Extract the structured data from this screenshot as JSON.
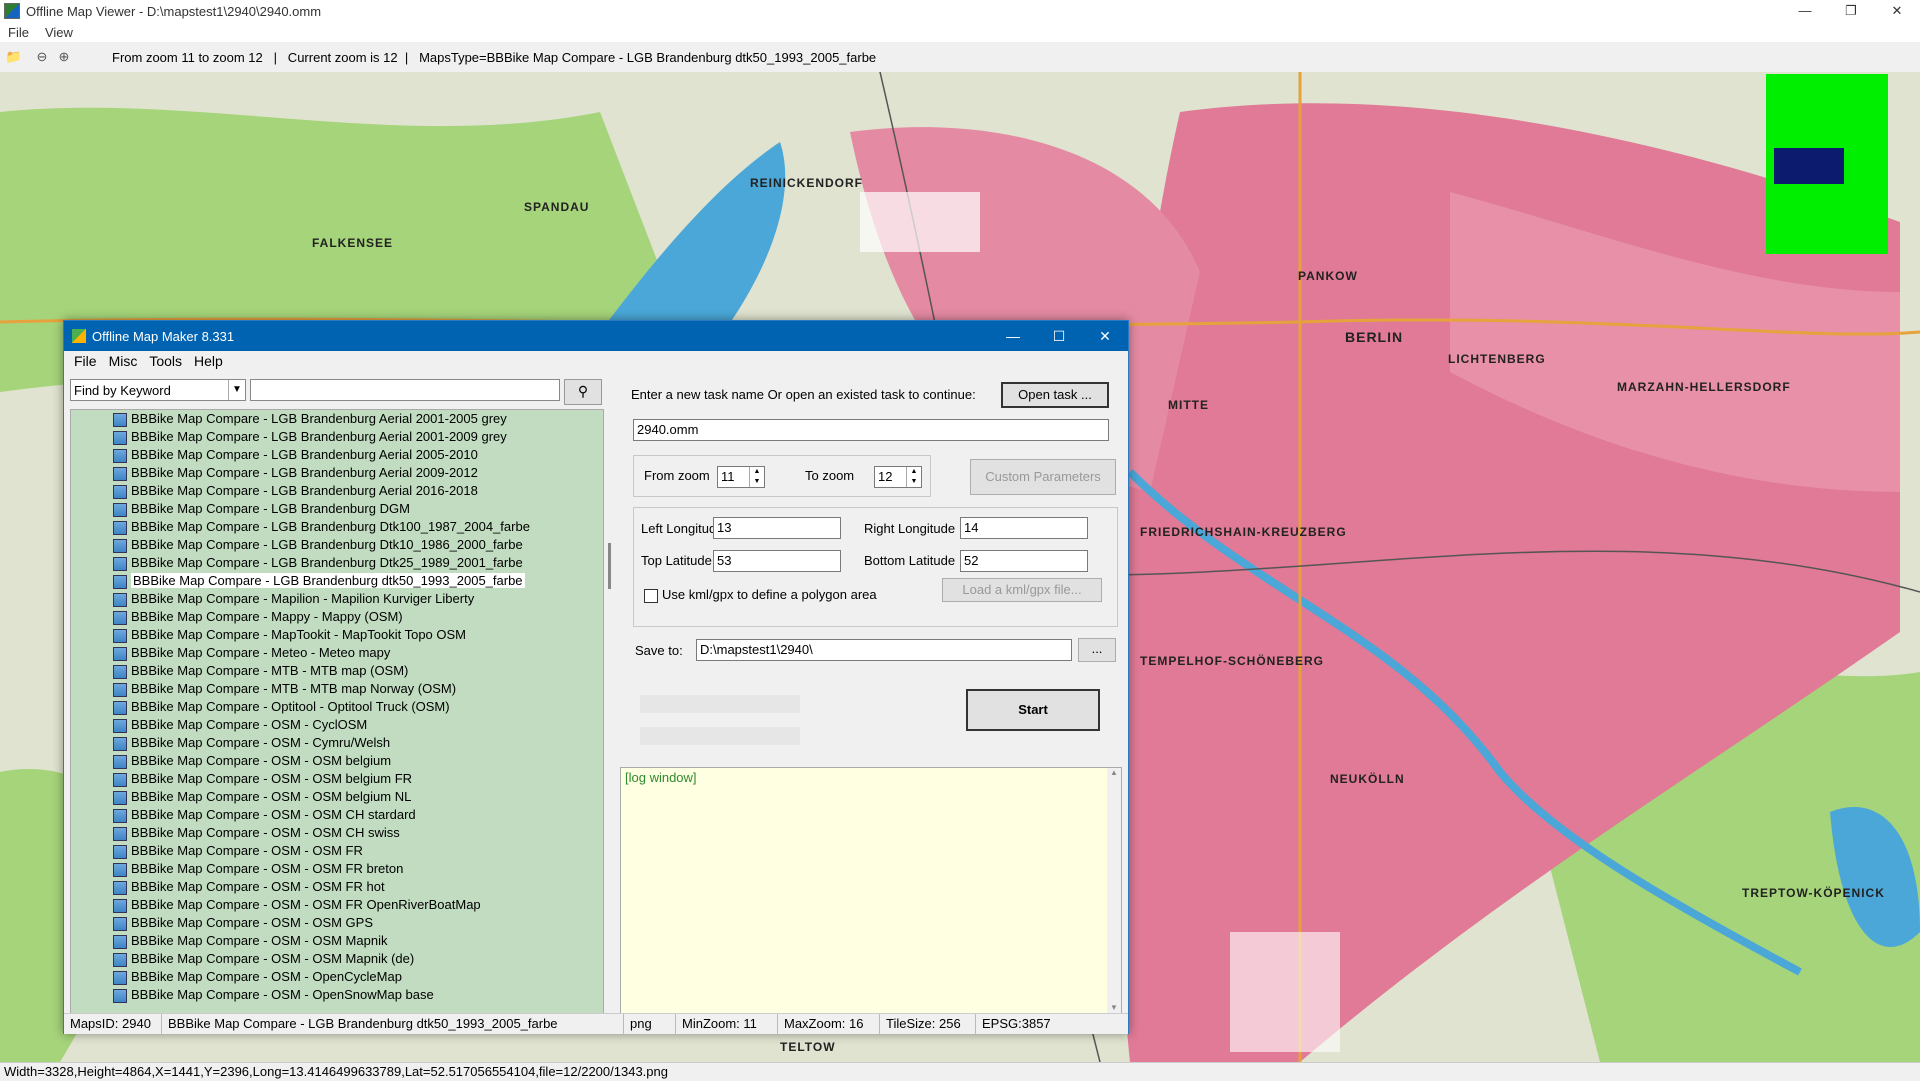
{
  "viewer": {
    "title": "Offline Map Viewer - D:\\mapstest1\\2940\\2940.omm",
    "menu": [
      "File",
      "View"
    ],
    "toolbar_text": "From zoom 11 to zoom 12   |   Current zoom is 12  |   MapsType=BBBike Map Compare - LGB Brandenburg dtk50_1993_2005_farbe",
    "status": "Width=3328,Height=4864,X=1441,Y=2396,Long=13.4146499633789,Lat=52.517056554104,file=12/2200/1343.png"
  },
  "map_labels": [
    "REINICKENDORF",
    "FALKENSEE",
    "PANKOW",
    "BERLIN",
    "LICHTENBERG",
    "MARZAHN-HELLERSDORF",
    "MITTE",
    "FRIEDRICHSHAIN-KREUZBERG",
    "TEMPELHOF-SCHÖNEBERG",
    "NEUKÖLLN",
    "TREPTOW-KÖPENICK",
    "SPANDAU",
    "TELTOW"
  ],
  "dialog": {
    "title": "Offline Map Maker 8.331",
    "menu": [
      "File",
      "Misc",
      "Tools",
      "Help"
    ],
    "find_select": "Find by Keyword",
    "keyword": "",
    "maps": [
      "BBBike Map Compare - LGB Brandenburg Aerial 2001-2005 grey",
      "BBBike Map Compare - LGB Brandenburg Aerial 2001-2009 grey",
      "BBBike Map Compare - LGB Brandenburg Aerial 2005-2010",
      "BBBike Map Compare - LGB Brandenburg Aerial 2009-2012",
      "BBBike Map Compare - LGB Brandenburg Aerial 2016-2018",
      "BBBike Map Compare - LGB Brandenburg DGM",
      "BBBike Map Compare - LGB Brandenburg Dtk100_1987_2004_farbe",
      "BBBike Map Compare - LGB Brandenburg Dtk10_1986_2000_farbe",
      "BBBike Map Compare - LGB Brandenburg Dtk25_1989_2001_farbe",
      "BBBike Map Compare - LGB Brandenburg dtk50_1993_2005_farbe",
      "BBBike Map Compare - Mapilion - Mapilion Kurviger Liberty",
      "BBBike Map Compare - Mappy - Mappy (OSM)",
      "BBBike Map Compare - MapTookit - MapTookit Topo OSM",
      "BBBike Map Compare - Meteo - Meteo mapy",
      "BBBike Map Compare - MTB - MTB map (OSM)",
      "BBBike Map Compare - MTB - MTB map Norway (OSM)",
      "BBBike Map Compare - Optitool - Optitool Truck (OSM)",
      "BBBike Map Compare - OSM - CyclOSM",
      "BBBike Map Compare - OSM - Cymru/Welsh",
      "BBBike Map Compare - OSM - OSM belgium",
      "BBBike Map Compare - OSM - OSM belgium FR",
      "BBBike Map Compare - OSM - OSM belgium NL",
      "BBBike Map Compare - OSM - OSM CH stardard",
      "BBBike Map Compare - OSM - OSM CH swiss",
      "BBBike Map Compare - OSM - OSM FR",
      "BBBike Map Compare - OSM - OSM FR breton",
      "BBBike Map Compare - OSM - OSM FR hot",
      "BBBike Map Compare - OSM - OSM FR OpenRiverBoatMap",
      "BBBike Map Compare - OSM - OSM GPS",
      "BBBike Map Compare - OSM - OSM Mapnik",
      "BBBike Map Compare - OSM - OSM Mapnik (de)",
      "BBBike Map Compare - OSM - OpenCycleMap",
      "BBBike Map Compare - OSM - OpenSnowMap base"
    ],
    "selected_index": 9,
    "task_prompt": "Enter a new task name Or open an existed task to continue:",
    "open_task_label": "Open task ...",
    "task_name": "2940.omm",
    "from_zoom_label": "From zoom",
    "from_zoom": "11",
    "to_zoom_label": "To zoom",
    "to_zoom": "12",
    "custom_params_label": "Custom Parameters",
    "left_lon_label": "Left Longitude",
    "left_lon": "13",
    "right_lon_label": "Right Longitude",
    "right_lon": "14",
    "top_lat_label": "Top Latitude",
    "top_lat": "53",
    "bottom_lat_label": "Bottom Latitude",
    "bottom_lat": "52",
    "kml_label": "Use kml/gpx to define a polygon area",
    "kml_checked": false,
    "load_kml_label": "Load a kml/gpx file...",
    "save_to_label": "Save to:",
    "save_to": "D:\\mapstest1\\2940\\",
    "browse_label": "...",
    "start_label": "Start",
    "log_text": "[log window]",
    "status": {
      "maps_id": "MapsID: 2940",
      "maps_name": "BBBike Map Compare - LGB Brandenburg dtk50_1993_2005_farbe",
      "format": "png",
      "min_zoom": "MinZoom: 11",
      "max_zoom": "MaxZoom: 16",
      "tile_size": "TileSize: 256",
      "epsg": "EPSG:3857"
    }
  },
  "colors": {
    "map_green": "#a6d47a",
    "map_urban": "#e07a96",
    "map_water": "#4aa7d8",
    "tree_bg": "#c1dcc1",
    "log_bg": "#ffffe1",
    "title_blue": "#0063b1"
  }
}
